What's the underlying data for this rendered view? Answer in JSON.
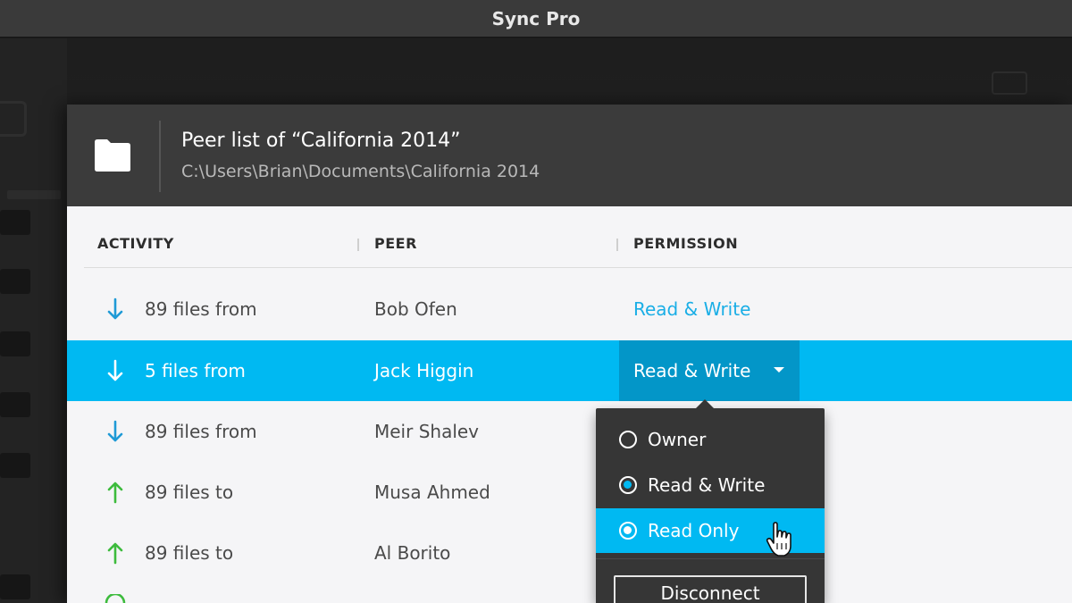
{
  "window": {
    "title": "Sync Pro"
  },
  "dialog": {
    "title": "Peer list of “California 2014”",
    "path": "C:\\Users\\Brian\\Documents\\California 2014"
  },
  "columns": {
    "activity": "ACTIVITY",
    "peer": "PEER",
    "permission": "PERMISSION"
  },
  "rows": [
    {
      "direction": "down",
      "activity": "89 files from",
      "peer": "Bob Ofen",
      "permission": "Read & Write"
    },
    {
      "direction": "down",
      "activity": "5 files from",
      "peer": "Jack Higgin",
      "permission": "Read & Write",
      "selected": true
    },
    {
      "direction": "down",
      "activity": "89 files from",
      "peer": "Meir Shalev",
      "permission": ""
    },
    {
      "direction": "up",
      "activity": "89 files to",
      "peer": "Musa Ahmed",
      "permission": ""
    },
    {
      "direction": "up",
      "activity": "89 files to",
      "peer": "Al Borito",
      "permission": ""
    }
  ],
  "menu": {
    "options": [
      {
        "label": "Owner",
        "checked": false
      },
      {
        "label": "Read & Write",
        "checked": true
      },
      {
        "label": "Read Only",
        "checked": false,
        "hovered": true
      }
    ],
    "disconnect_label": "Disconnect"
  },
  "colors": {
    "accent": "#00b9f2",
    "accent_dark": "#0396c8",
    "download_arrow": "#1f9ad6",
    "upload_arrow": "#3dbb3d"
  }
}
